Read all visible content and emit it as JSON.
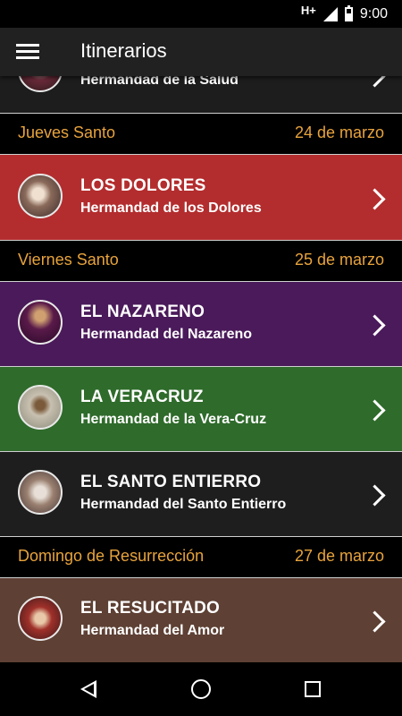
{
  "status": {
    "network": "H+",
    "time": "9:00"
  },
  "app": {
    "title": "Itinerarios"
  },
  "colors": {
    "accent": "#e8a33c",
    "salud": "#1d1d1d",
    "dolores": "#b32d2e",
    "nazareno": "#4a1a5a",
    "veracruz": "#2f6b2b",
    "entierro": "#1e1e1e",
    "resucitado": "#5e4034"
  },
  "top_item": {
    "subtitle": "Hermandad de la Salud"
  },
  "sections": [
    {
      "day": "Jueves Santo",
      "date": "24 de marzo"
    },
    {
      "day": "Viernes Santo",
      "date": "25 de marzo"
    },
    {
      "day": "Domingo de Resurrección",
      "date": "27 de marzo"
    }
  ],
  "items": [
    {
      "name": "LOS DOLORES",
      "subtitle": "Hermandad de los Dolores"
    },
    {
      "name": "EL NAZARENO",
      "subtitle": "Hermandad del Nazareno"
    },
    {
      "name": "LA VERACRUZ",
      "subtitle": "Hermandad de la Vera-Cruz"
    },
    {
      "name": "EL SANTO ENTIERRO",
      "subtitle": "Hermandad del Santo Entierro"
    },
    {
      "name": "EL RESUCITADO",
      "subtitle": "Hermandad del Amor"
    }
  ]
}
